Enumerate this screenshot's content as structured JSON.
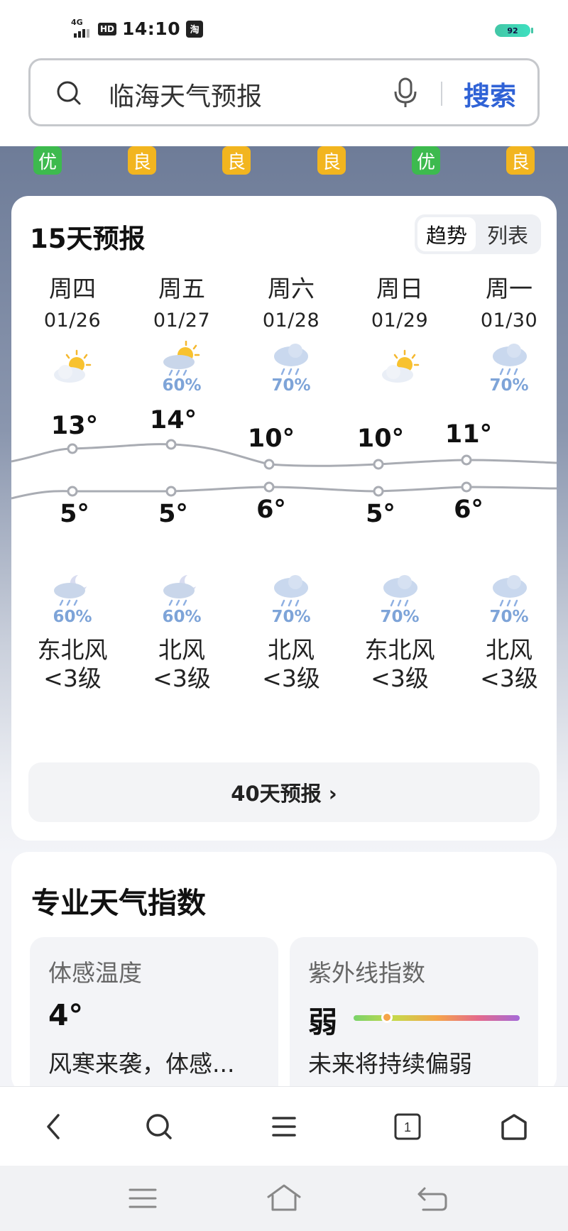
{
  "status": {
    "network": "4G",
    "hd": "HD",
    "time": "14:10",
    "app_badge": "淘",
    "battery": "92"
  },
  "search": {
    "query": "临海天气预报",
    "button": "搜索"
  },
  "aqi": [
    {
      "label": "优",
      "level": "good"
    },
    {
      "label": "良",
      "level": "fair"
    },
    {
      "label": "良",
      "level": "fair"
    },
    {
      "label": "良",
      "level": "fair"
    },
    {
      "label": "优",
      "level": "good"
    },
    {
      "label": "良",
      "level": "fair"
    }
  ],
  "forecast": {
    "title": "15天预报",
    "toggle": [
      "趋势",
      "列表"
    ],
    "days": [
      {
        "weekday": "周四",
        "date": "01/26",
        "day_icon": "partly-cloudy-icon",
        "day_pct": "",
        "high": "13°",
        "low": "5°",
        "night_icon": "moon-cloud-rain-icon",
        "night_pct": "60%",
        "wind_dir": "东北风",
        "wind_level": "<3级"
      },
      {
        "weekday": "周五",
        "date": "01/27",
        "day_icon": "sun-cloud-rain-icon",
        "day_pct": "60%",
        "high": "14°",
        "low": "5°",
        "night_icon": "moon-cloud-rain-icon",
        "night_pct": "60%",
        "wind_dir": "北风",
        "wind_level": "<3级"
      },
      {
        "weekday": "周六",
        "date": "01/28",
        "day_icon": "rain-cloud-icon",
        "day_pct": "70%",
        "high": "10°",
        "low": "6°",
        "night_icon": "rain-cloud-icon",
        "night_pct": "70%",
        "wind_dir": "北风",
        "wind_level": "<3级"
      },
      {
        "weekday": "周日",
        "date": "01/29",
        "day_icon": "partly-cloudy-icon",
        "day_pct": "",
        "high": "10°",
        "low": "5°",
        "night_icon": "rain-cloud-icon",
        "night_pct": "70%",
        "wind_dir": "东北风",
        "wind_level": "<3级"
      },
      {
        "weekday": "周一",
        "date": "01/30",
        "day_icon": "rain-cloud-icon",
        "day_pct": "70%",
        "high": "11°",
        "low": "6°",
        "night_icon": "rain-cloud-icon",
        "night_pct": "70%",
        "wind_dir": "北风",
        "wind_level": "<3级"
      }
    ],
    "more": "40天预报 ›"
  },
  "indices": {
    "title": "专业天气指数",
    "feels": {
      "label": "体感温度",
      "value": "4°",
      "desc": "风寒来袭，体感..."
    },
    "uv": {
      "label": "紫外线指数",
      "value": "弱",
      "desc": "未来将持续偏弱",
      "level": 0.2
    }
  },
  "toolbar": [
    "back-icon",
    "search-icon",
    "menu-icon",
    "tabs-icon",
    "home-icon"
  ],
  "tabs_count": "1",
  "navbar": [
    "recent-apps-icon",
    "home-icon",
    "back-icon"
  ]
}
